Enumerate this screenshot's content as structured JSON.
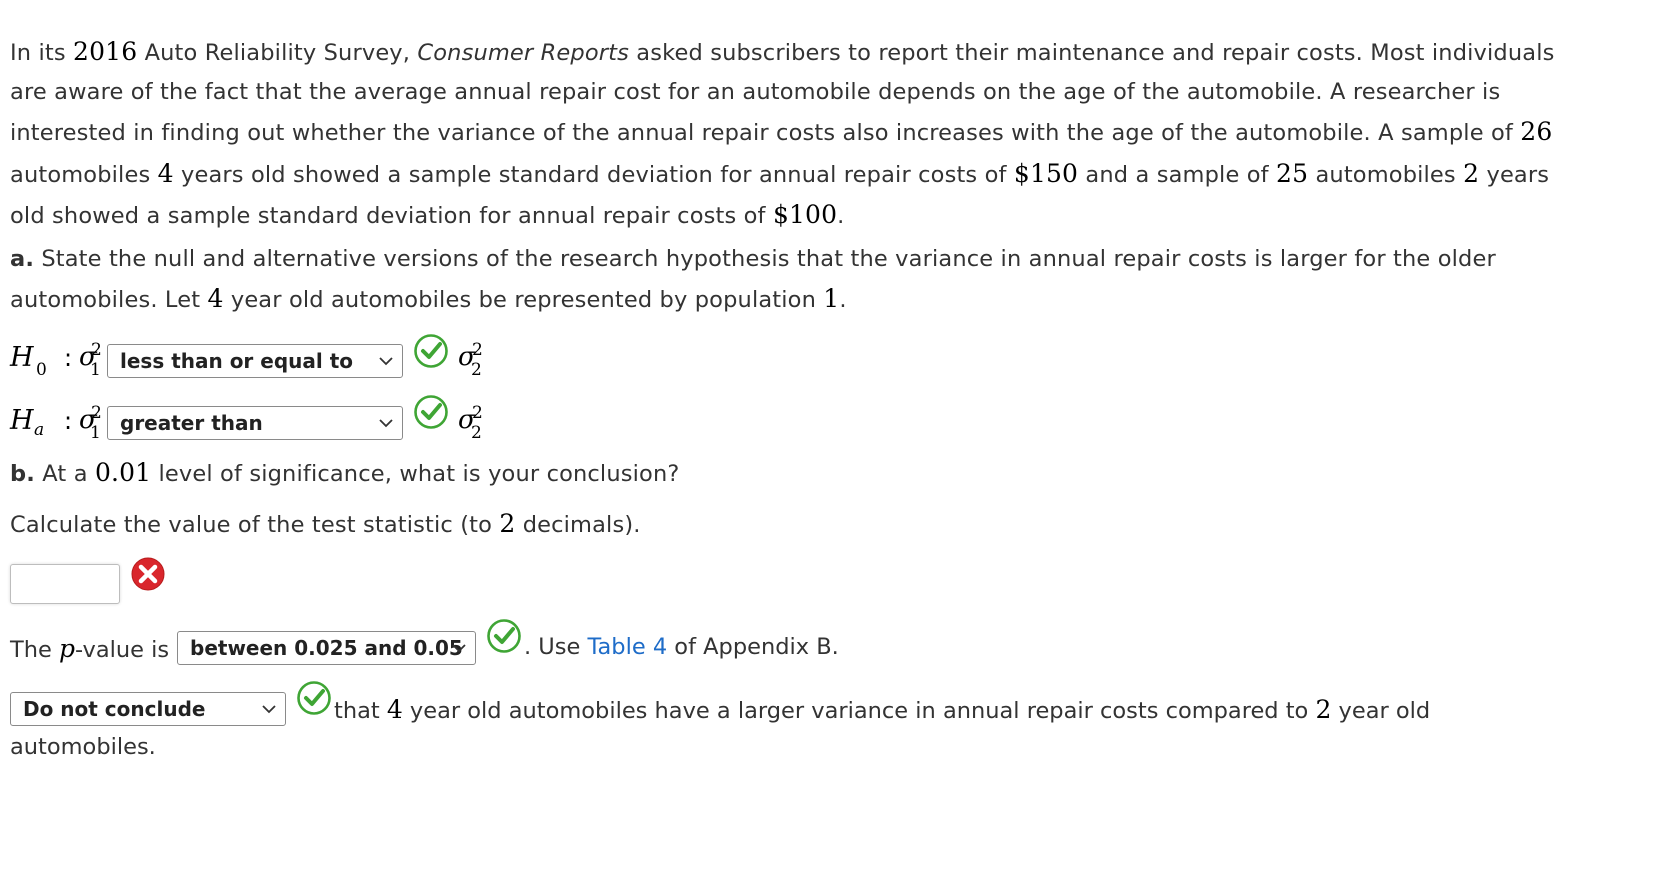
{
  "intro": {
    "t1": "In its ",
    "year": "2016",
    "t2": " Auto Reliability Survey, ",
    "source": "Consumer Reports",
    "t3": " asked subscribers to report their maintenance and repair costs. Most individuals are aware of the fact that the average annual repair cost for an automobile depends on the age of the automobile. A researcher is interested in finding out whether the variance of the annual repair costs also increases with the age of the automobile. A sample of ",
    "n1": "26",
    "t4": " automobiles ",
    "age1": "4",
    "t5": " years old showed a sample standard deviation for annual repair costs of ",
    "s1": "$150",
    "t6": " and a sample of ",
    "n2": "25",
    "t7": " automobiles ",
    "age2": "2",
    "t8": " years old showed a sample standard deviation for annual repair costs of ",
    "s2": "$100",
    "t9": "."
  },
  "part_a": {
    "label": "a.",
    "t1": " State the null and alternative versions of the research hypothesis that the variance in annual repair costs is larger for the older automobiles. Let ",
    "age": "4",
    "t2": " year old automobiles be represented by population ",
    "pop": "1",
    "t3": "."
  },
  "h0": {
    "H": "H",
    "sub": "0",
    "colon": ":",
    "sigma": "σ",
    "sup": "2",
    "sub_left": "1",
    "sub_right": "2",
    "selected": "less than or equal to",
    "status": "correct"
  },
  "ha": {
    "H": "H",
    "sub": "a",
    "colon": ":",
    "sigma": "σ",
    "sup": "2",
    "sub_left": "1",
    "sub_right": "2",
    "selected": "greater than",
    "status": "correct"
  },
  "part_b": {
    "label": "b.",
    "t1": " At a ",
    "alpha": "0.01",
    "t2": " level of significance, what is your conclusion?"
  },
  "test_stat": {
    "t1": "Calculate the value of the test statistic (to ",
    "dec": "2",
    "t2": " decimals).",
    "value": "",
    "status": "incorrect"
  },
  "pvalue": {
    "t1": "The ",
    "p": "p",
    "t2": "-value is",
    "selected": "between 0.025 and 0.05",
    "status": "correct",
    "t3": ". Use ",
    "link": "Table 4",
    "t4": " of Appendix B."
  },
  "conclusion": {
    "selected": "Do not conclude",
    "status": "correct",
    "t1": " that ",
    "age1": "4",
    "t2": " year old automobiles have a larger variance in annual repair costs compared to ",
    "age2": "2",
    "t3": " year old",
    "t4": "automobiles."
  },
  "colors": {
    "correct": "#3fa535",
    "incorrect": "#d9262c",
    "link": "#1e6cc8"
  }
}
